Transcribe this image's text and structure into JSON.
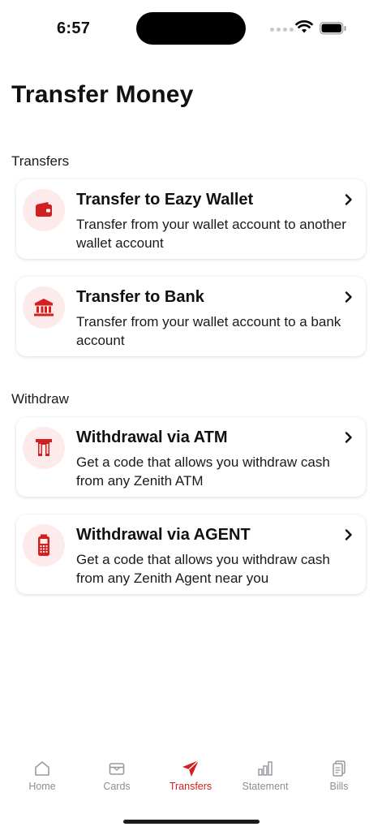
{
  "status": {
    "time": "6:57"
  },
  "header": {
    "title": "Transfer Money"
  },
  "sections": {
    "transfers": {
      "label": "Transfers",
      "items": [
        {
          "title": "Transfer to Eazy Wallet",
          "description": "Transfer from your wallet account to another wallet account",
          "icon": "wallet-icon"
        },
        {
          "title": "Transfer to Bank",
          "description": "Transfer from your wallet account to a bank account",
          "icon": "bank-icon"
        }
      ]
    },
    "withdraw": {
      "label": "Withdraw",
      "items": [
        {
          "title": "Withdrawal via ATM",
          "description": "Get a code that allows you withdraw cash from any Zenith ATM",
          "icon": "atm-icon"
        },
        {
          "title": "Withdrawal via AGENT",
          "description": "Get a code that allows you withdraw cash from any Zenith Agent near you",
          "icon": "pos-terminal-icon"
        }
      ]
    }
  },
  "tabs": [
    {
      "label": "Home",
      "icon": "home-icon"
    },
    {
      "label": "Cards",
      "icon": "card-icon"
    },
    {
      "label": "Transfers",
      "icon": "send-icon",
      "active": true
    },
    {
      "label": "Statement",
      "icon": "chart-icon"
    },
    {
      "label": "Bills",
      "icon": "bills-icon"
    }
  ],
  "colors": {
    "accent": "#d21f1f",
    "icon_bg": "#fcebea",
    "inactive": "#8e8e93"
  }
}
